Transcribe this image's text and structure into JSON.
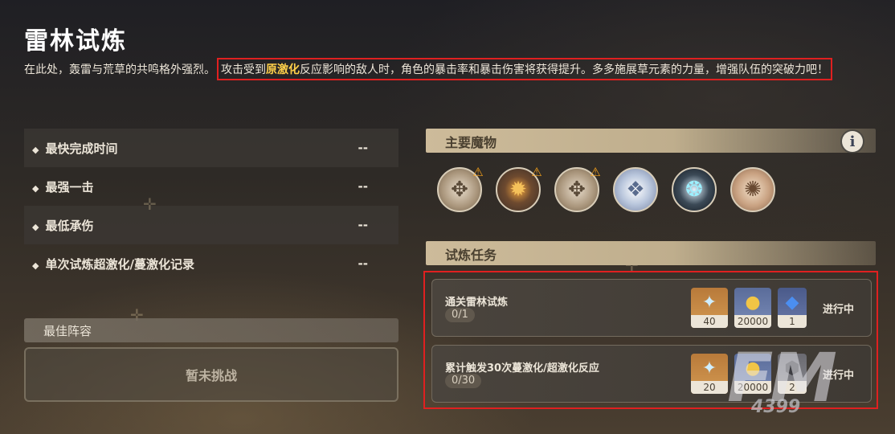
{
  "page": {
    "title": "雷林试炼",
    "description_prefix": "在此处，轰雷与荒草的共鸣格外强烈。",
    "description_part1": "攻击受到",
    "description_highlight": "原激化",
    "description_part2": "反应影响的敌人时，角色的暴击率和暴击伤害将获得提升。多多施展草元素的力量，增强队伍的突破力吧！"
  },
  "stats": [
    {
      "label": "最快完成时间",
      "value": "--"
    },
    {
      "label": "最强一击",
      "value": "--"
    },
    {
      "label": "最低承伤",
      "value": "--"
    },
    {
      "label": "单次试炼超激化/蔓激化记录",
      "value": "--"
    }
  ],
  "best_team": {
    "header": "最佳阵容",
    "empty_text": "暂未挑战"
  },
  "monsters_section": {
    "header": "主要魔物",
    "info_glyph": "i",
    "monsters": [
      {
        "icon": "ruin-drake-icon",
        "glyph": "✥",
        "warning": true
      },
      {
        "icon": "ruin-grader-icon",
        "glyph": "✹",
        "warning": true
      },
      {
        "icon": "ruin-drake-icon",
        "glyph": "✥",
        "warning": true
      },
      {
        "icon": "ruin-scout-icon",
        "glyph": "❖",
        "warning": false
      },
      {
        "icon": "ruin-defender-icon",
        "glyph": "❂",
        "warning": false
      },
      {
        "icon": "ruin-hunter-icon",
        "glyph": "✺",
        "warning": false
      }
    ]
  },
  "tasks_section": {
    "header": "试炼任务",
    "tasks": [
      {
        "name": "通关雷林试炼",
        "progress": "0/1",
        "status": "进行中",
        "rewards": [
          {
            "icon": "primogem-icon",
            "glyph": "✦",
            "count": "40"
          },
          {
            "icon": "mora-icon",
            "glyph": "●",
            "count": "20000"
          },
          {
            "icon": "crystal-icon",
            "glyph": "◆",
            "count": "1"
          }
        ]
      },
      {
        "name": "累计触发30次蔓激化/超激化反应",
        "progress": "0/30",
        "status": "进行中",
        "rewards": [
          {
            "icon": "primogem-icon",
            "glyph": "✦",
            "count": "20"
          },
          {
            "icon": "mora-icon",
            "glyph": "●",
            "count": "20000"
          },
          {
            "icon": "ore-icon",
            "glyph": "⬢",
            "count": "2"
          }
        ]
      }
    ]
  },
  "watermark": {
    "big": "FM",
    "small": "4399"
  },
  "colors": {
    "highlight": "#ffd04a",
    "annotation_box": "#e02020",
    "header_bg": "#cdbb9a"
  }
}
